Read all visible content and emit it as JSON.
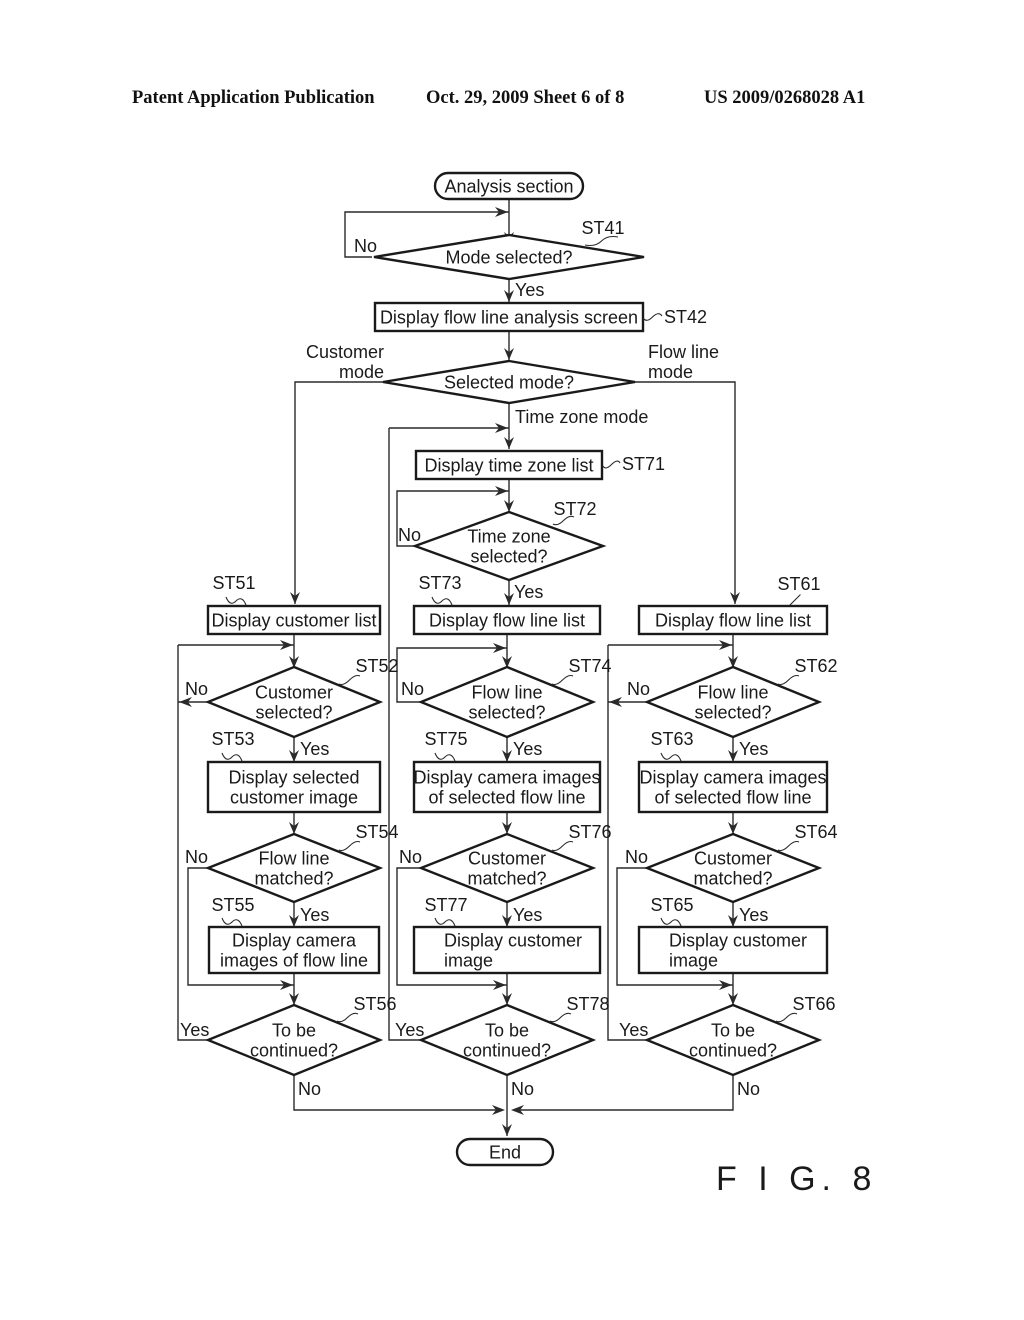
{
  "header": {
    "left": "Patent Application Publication",
    "middle": "Oct. 29, 2009   Sheet 6 of 8",
    "right": "US 2009/0268028 A1"
  },
  "figure_label": "F I G. 8",
  "flowchart": {
    "start": {
      "label": "Analysis section"
    },
    "end": {
      "label": "End"
    },
    "nodes": {
      "ST41": {
        "step": "ST41",
        "type": "decision",
        "lines": [
          "Mode selected?"
        ]
      },
      "ST42": {
        "step": "ST42",
        "type": "process",
        "lines": [
          "Display flow line analysis screen"
        ]
      },
      "MODE": {
        "step": "",
        "type": "decision",
        "lines": [
          "Selected mode?"
        ]
      },
      "ST71": {
        "step": "ST71",
        "type": "process",
        "lines": [
          "Display time zone list"
        ]
      },
      "ST72": {
        "step": "ST72",
        "type": "decision",
        "lines": [
          "Time zone",
          "selected?"
        ]
      },
      "ST51": {
        "step": "ST51",
        "type": "process",
        "lines": [
          "Display customer list"
        ]
      },
      "ST52": {
        "step": "ST52",
        "type": "decision",
        "lines": [
          "Customer",
          "selected?"
        ]
      },
      "ST53": {
        "step": "ST53",
        "type": "process",
        "lines": [
          "Display selected",
          "customer image"
        ]
      },
      "ST54": {
        "step": "ST54",
        "type": "decision",
        "lines": [
          "Flow line",
          "matched?"
        ]
      },
      "ST55": {
        "step": "ST55",
        "type": "process",
        "lines": [
          "Display camera",
          "images of flow line"
        ]
      },
      "ST56": {
        "step": "ST56",
        "type": "decision",
        "lines": [
          "To be",
          "continued?"
        ]
      },
      "ST73": {
        "step": "ST73",
        "type": "process",
        "lines": [
          "Display flow line list"
        ]
      },
      "ST74": {
        "step": "ST74",
        "type": "decision",
        "lines": [
          "Flow line",
          "selected?"
        ]
      },
      "ST75": {
        "step": "ST75",
        "type": "process",
        "lines": [
          "Display camera images",
          "of selected flow line"
        ]
      },
      "ST76": {
        "step": "ST76",
        "type": "decision",
        "lines": [
          "Customer",
          "matched?"
        ]
      },
      "ST77": {
        "step": "ST77",
        "type": "process",
        "lines": [
          "Display customer",
          "image"
        ]
      },
      "ST78": {
        "step": "ST78",
        "type": "decision",
        "lines": [
          "To be",
          "continued?"
        ]
      },
      "ST61": {
        "step": "ST61",
        "type": "process",
        "lines": [
          "Display flow line list"
        ]
      },
      "ST62": {
        "step": "ST62",
        "type": "decision",
        "lines": [
          "Flow line",
          "selected?"
        ]
      },
      "ST63": {
        "step": "ST63",
        "type": "process",
        "lines": [
          "Display camera images",
          "of selected flow line"
        ]
      },
      "ST64": {
        "step": "ST64",
        "type": "decision",
        "lines": [
          "Customer",
          "matched?"
        ]
      },
      "ST65": {
        "step": "ST65",
        "type": "process",
        "lines": [
          "Display customer",
          "image"
        ]
      },
      "ST66": {
        "step": "ST66",
        "type": "decision",
        "lines": [
          "To be",
          "continued?"
        ]
      }
    },
    "edge_labels": {
      "yes": "Yes",
      "no": "No",
      "customer_mode": [
        "Customer",
        "mode"
      ],
      "flow_line_mode": [
        "Flow line",
        "mode"
      ],
      "time_zone_mode": "Time zone mode"
    }
  }
}
